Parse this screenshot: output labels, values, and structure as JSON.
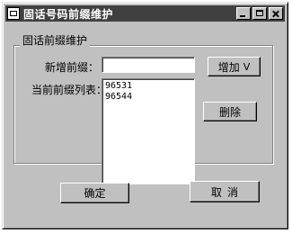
{
  "window": {
    "title": "固话号码前缀维护"
  },
  "group": {
    "label": "固话前缀维护"
  },
  "form": {
    "new_prefix_label": "新增前缀：",
    "new_prefix_value": "",
    "current_list_label": "当前前缀列表："
  },
  "prefix_list": [
    "96531",
    "96544"
  ],
  "buttons": {
    "add": "增加",
    "add_icon": "V",
    "delete": "删除",
    "ok": "确定",
    "cancel": "取消"
  }
}
